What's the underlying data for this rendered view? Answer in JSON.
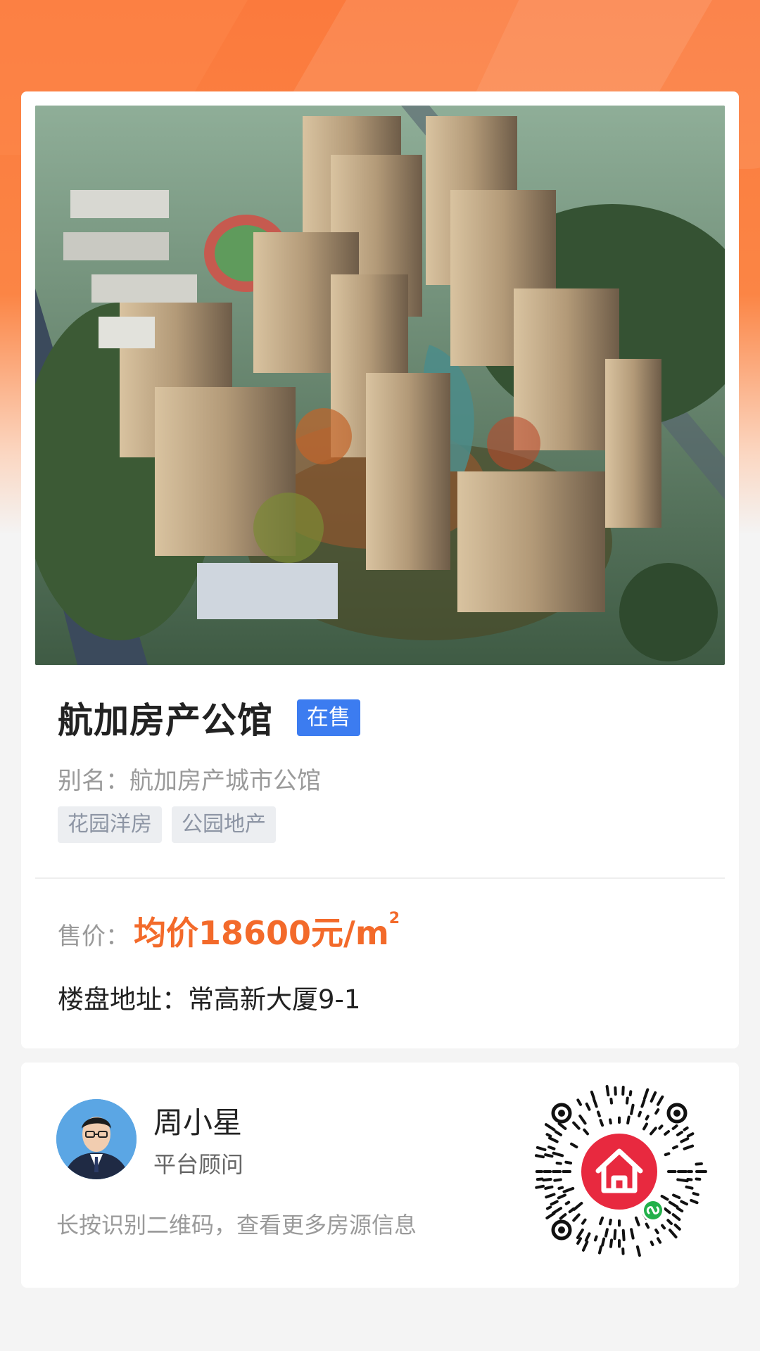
{
  "property": {
    "name": "航加房产公馆",
    "status": "在售",
    "alias_label": "别名：",
    "alias": "航加房产城市公馆",
    "tags": [
      "花园洋房",
      "公园地产"
    ],
    "price_label": "售价：",
    "price": "均价18600元/m",
    "price_sup": "2",
    "address_label": "楼盘地址：",
    "address": "常高新大厦9-1"
  },
  "agent": {
    "name": "周小星",
    "role": "平台顾问",
    "hint": "长按识别二维码，查看更多房源信息"
  },
  "colors": {
    "header_orange": "#fb7a3d",
    "status_blue": "#3c7cf0",
    "price_orange": "#f36a2a",
    "qr_red": "#e8293f",
    "wechat_green": "#22b04a"
  },
  "icons": {
    "qr_center": "house-icon",
    "qr_badge": "wechat-mini-program-icon"
  }
}
